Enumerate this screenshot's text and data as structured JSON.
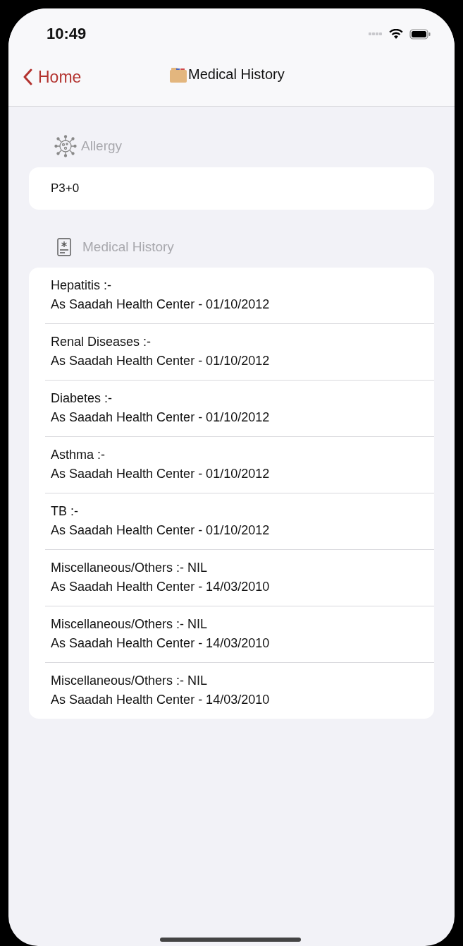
{
  "status_bar": {
    "time": "10:49"
  },
  "nav": {
    "back": "Home",
    "title": "Medical History"
  },
  "allergy": {
    "header": "Allergy",
    "value": "P3+0"
  },
  "history": {
    "header": "Medical History",
    "items": [
      {
        "title": "Hepatitis :-",
        "detail": "As Saadah Health Center - 01/10/2012"
      },
      {
        "title": "Renal Diseases :-",
        "detail": "As Saadah Health Center - 01/10/2012"
      },
      {
        "title": "Diabetes :-",
        "detail": "As Saadah Health Center - 01/10/2012"
      },
      {
        "title": "Asthma :-",
        "detail": "As Saadah Health Center - 01/10/2012"
      },
      {
        "title": "TB :-",
        "detail": "As Saadah Health Center - 01/10/2012"
      },
      {
        "title": "Miscellaneous/Others :- NIL",
        "detail": "As Saadah Health Center - 14/03/2010"
      },
      {
        "title": "Miscellaneous/Others :- NIL",
        "detail": "As Saadah Health Center - 14/03/2010"
      },
      {
        "title": "Miscellaneous/Others :- NIL",
        "detail": "As Saadah Health Center - 14/03/2010"
      }
    ]
  }
}
